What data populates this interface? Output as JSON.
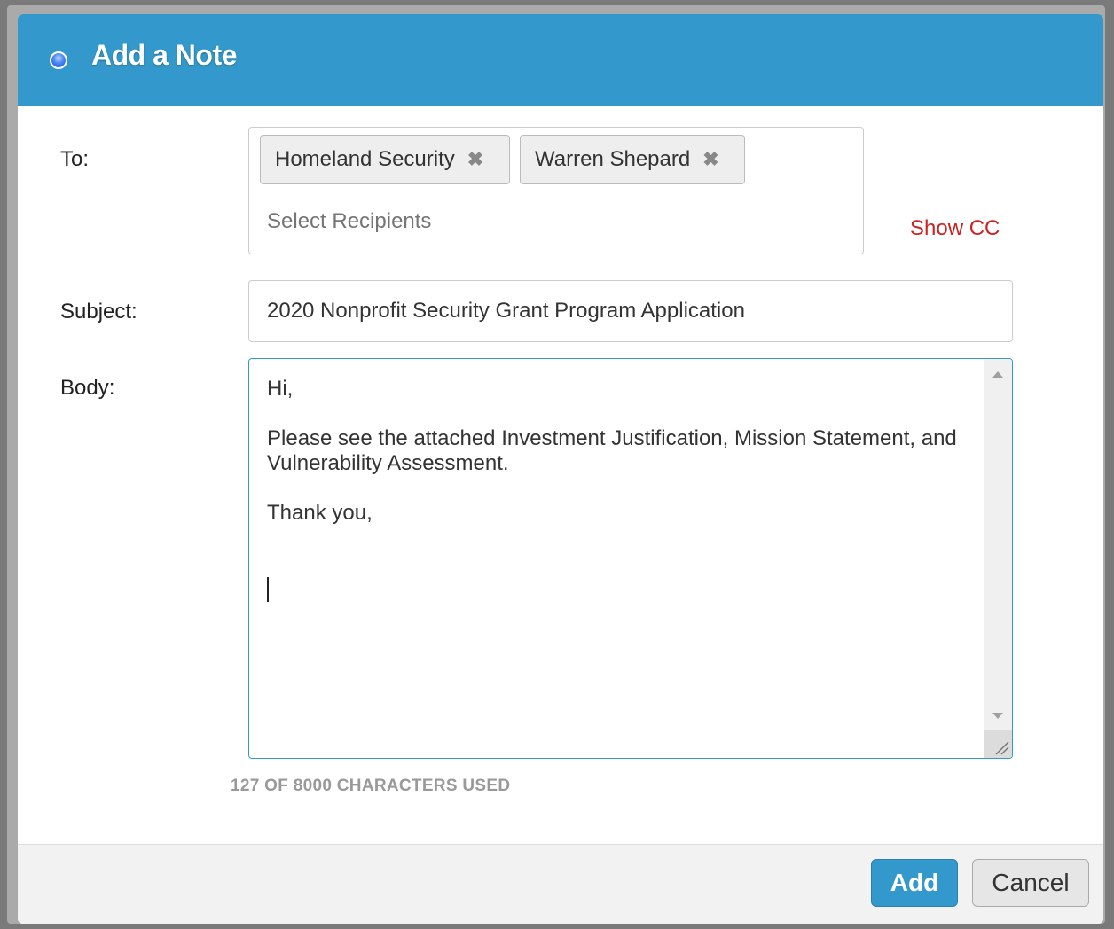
{
  "dialog": {
    "title": "Add a Note"
  },
  "form": {
    "to_label": "To:",
    "subject_label": "Subject:",
    "body_label": "Body:",
    "recipients": [
      {
        "name": "Homeland Security"
      },
      {
        "name": "Warren Shepard"
      }
    ],
    "recipients_placeholder": "Select Recipients",
    "show_cc": "Show CC",
    "subject_value": "2020 Nonprofit Security Grant Program Application",
    "body_lines": [
      "Hi,",
      "Please see the attached Investment Justification, Mission Statement, and Vulnerability Assessment.",
      "Thank you,"
    ],
    "char_count": "127 OF 8000 CHARACTERS USED"
  },
  "footer": {
    "add_label": "Add",
    "cancel_label": "Cancel"
  },
  "colors": {
    "header": "#3399cc",
    "show_cc": "#cc2222",
    "add_button": "#3399cc"
  },
  "icons": {
    "remove_chip": "close-icon",
    "header_dot": "status-dot-icon"
  }
}
